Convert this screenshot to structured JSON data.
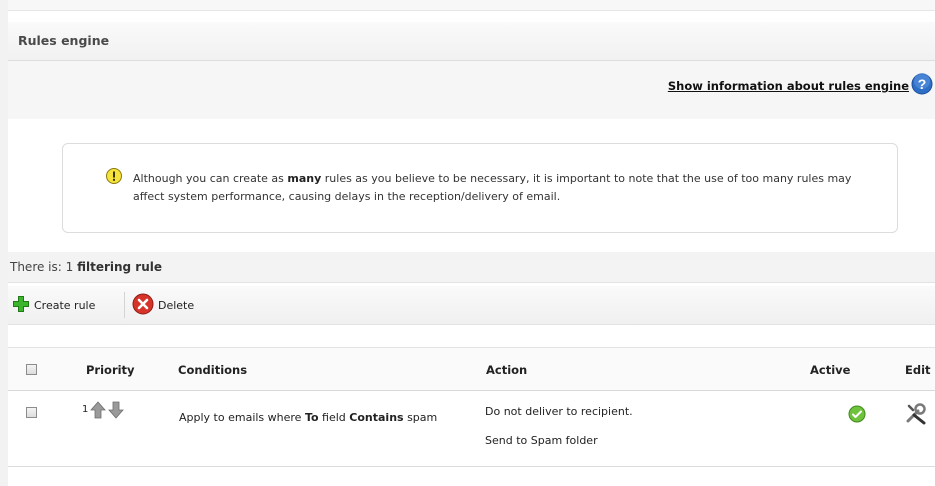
{
  "header": {
    "title": "Rules engine"
  },
  "info": {
    "link_label": "Show information about rules engine"
  },
  "notice": {
    "part1": "Although you can create as ",
    "bold": "many",
    "part2": " rules as you believe to be necessary, it is important to note that the use of too many rules may affect system performance, causing delays in the reception/delivery of email."
  },
  "count": {
    "prefix": "There is: 1 ",
    "bold": "filtering rule"
  },
  "toolbar": {
    "create_label": "Create rule",
    "delete_label": "Delete"
  },
  "table": {
    "headers": {
      "priority": "Priority",
      "conditions": "Conditions",
      "action": "Action",
      "active": "Active",
      "edit": "Edit"
    },
    "rows": [
      {
        "priority": "1",
        "cond_pre": "Apply to emails where ",
        "cond_field": "To",
        "cond_mid": " field ",
        "cond_op": "Contains",
        "cond_value": " spam",
        "action1": "Do not deliver to recipient.",
        "action2": "Send to Spam folder"
      }
    ]
  },
  "colors": {
    "help_blue": "#2d6fc6",
    "add_green": "#3bb42e",
    "delete_red": "#d6342a",
    "active_green": "#6fc23c"
  }
}
